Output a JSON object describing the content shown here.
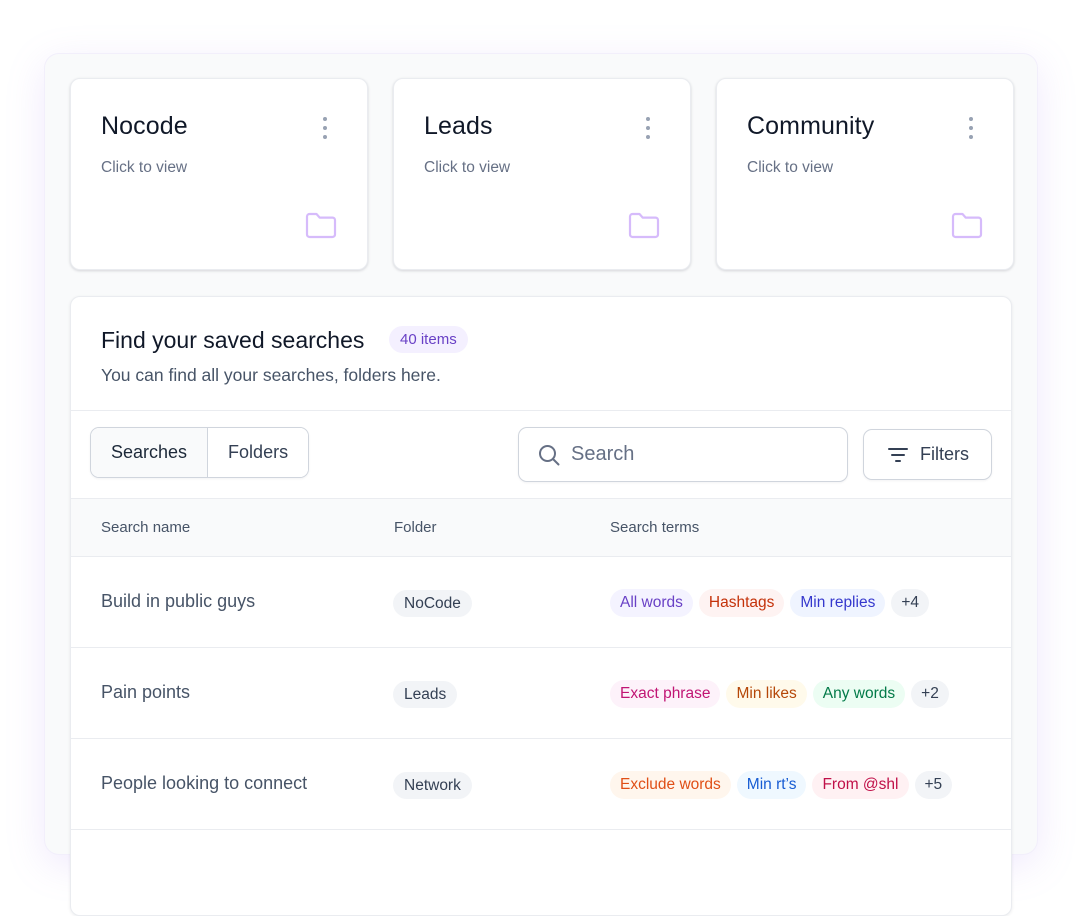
{
  "folders": [
    {
      "title": "Nocode",
      "subtitle": "Click to view"
    },
    {
      "title": "Leads",
      "subtitle": "Click to view"
    },
    {
      "title": "Community",
      "subtitle": "Click to view"
    }
  ],
  "panel": {
    "title": "Find your saved searches",
    "count_badge": "40 items",
    "subtitle": "You can find all your searches, folders here."
  },
  "toolbar": {
    "tabs": [
      "Searches",
      "Folders"
    ],
    "active_tab": "Searches",
    "search_placeholder": "Search",
    "search_value": "",
    "filters_label": "Filters"
  },
  "table": {
    "columns": [
      "Search name",
      "Folder",
      "Search terms"
    ],
    "rows": [
      {
        "name": "Build in public guys",
        "folder": "NoCode",
        "terms": [
          {
            "label": "All words",
            "bg": "#f4f3ff",
            "fg": "#6941c6"
          },
          {
            "label": "Hashtags",
            "bg": "#fef3f2",
            "fg": "#c4320a"
          },
          {
            "label": "Min replies",
            "bg": "#eff4ff",
            "fg": "#3538cd"
          }
        ],
        "more": "+4"
      },
      {
        "name": "Pain points",
        "folder": "Leads",
        "terms": [
          {
            "label": "Exact phrase",
            "bg": "#fdf2fa",
            "fg": "#c11574"
          },
          {
            "label": "Min likes",
            "bg": "#fffaeb",
            "fg": "#b54708"
          },
          {
            "label": "Any words",
            "bg": "#ecfdf3",
            "fg": "#027a48"
          }
        ],
        "more": "+2"
      },
      {
        "name": "People looking to connect",
        "folder": "Network",
        "terms": [
          {
            "label": "Exclude words",
            "bg": "#fff6ed",
            "fg": "#e04f16"
          },
          {
            "label": "Min rt’s",
            "bg": "#eff8ff",
            "fg": "#175cd3"
          },
          {
            "label": "From @shl",
            "bg": "#fff1f3",
            "fg": "#c01048"
          }
        ],
        "more": "+5"
      }
    ]
  },
  "icons": {
    "card_menu": "more-vertical-icon",
    "card_folder": "folder-icon",
    "search": "search-icon",
    "filters": "filter-lines-icon"
  },
  "colors": {
    "accent": "#6941c6",
    "folder_icon": "#d6bbfb"
  }
}
